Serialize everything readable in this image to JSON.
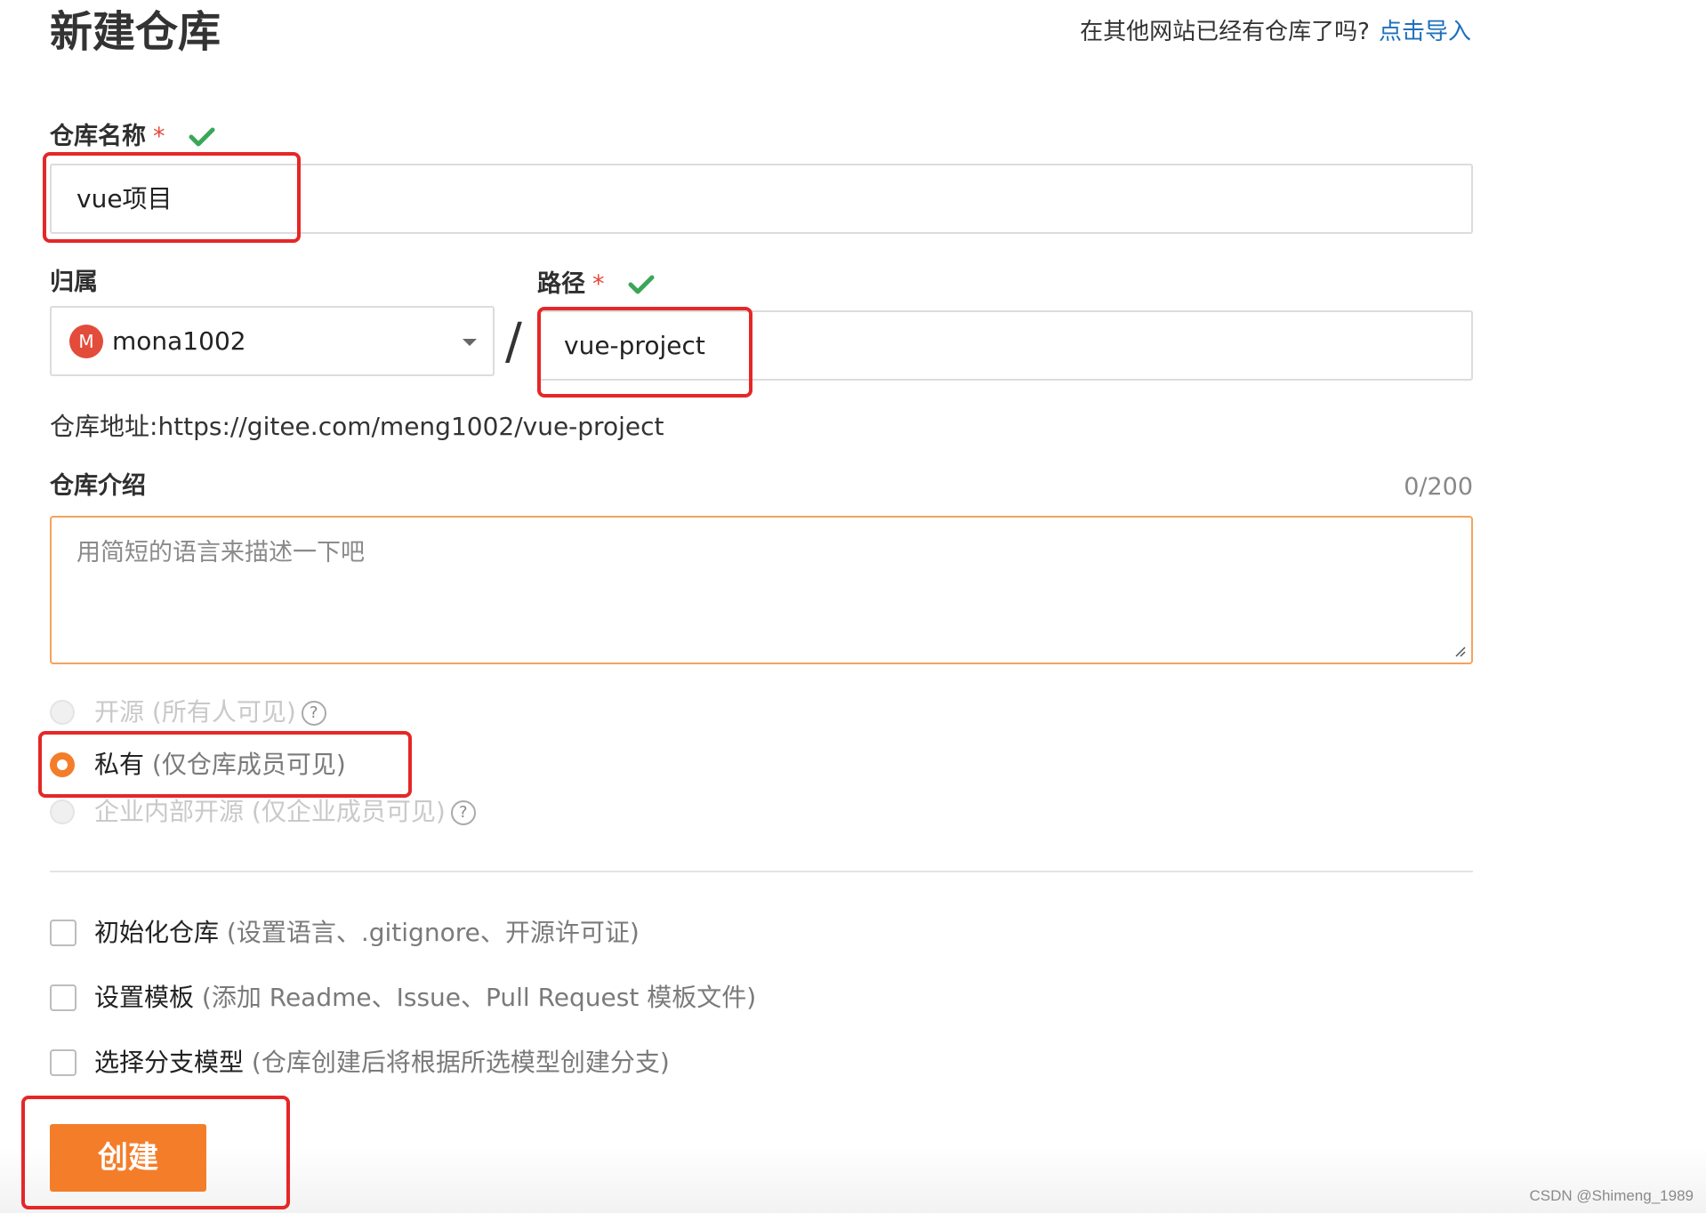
{
  "header": {
    "title": "新建仓库",
    "import_hint": "在其他网站已经有仓库了吗?",
    "import_link": "点击导入"
  },
  "form": {
    "repo_name": {
      "label": "仓库名称",
      "required_mark": "*",
      "value": "vue项目"
    },
    "owner": {
      "label": "归属",
      "avatar_letter": "M",
      "value": "mona1002"
    },
    "separator": "/",
    "path": {
      "label": "路径",
      "required_mark": "*",
      "value": "vue-project"
    },
    "repo_url": {
      "label": "仓库地址:",
      "value": "https://gitee.com/meng1002/vue-project"
    },
    "description": {
      "label": "仓库介绍",
      "counter": "0/200",
      "placeholder": "用简短的语言来描述一下吧"
    },
    "visibility": [
      {
        "label": "开源",
        "note": "(所有人可见)",
        "state": "disabled",
        "help": "?"
      },
      {
        "label": "私有",
        "note": "(仅仓库成员可见)",
        "state": "checked"
      },
      {
        "label": "企业内部开源",
        "note": "(仅企业成员可见)",
        "state": "disabled",
        "help": "?"
      }
    ],
    "options": [
      {
        "label": "初始化仓库",
        "note": "(设置语言、.gitignore、开源许可证)",
        "checked": false
      },
      {
        "label": "设置模板",
        "note": "(添加 Readme、Issue、Pull Request 模板文件)",
        "checked": false
      },
      {
        "label": "选择分支模型",
        "note": "(仓库创建后将根据所选模型创建分支)",
        "checked": false
      }
    ],
    "submit_label": "创建"
  },
  "watermark": "CSDN @Shimeng_1989",
  "colors": {
    "accent": "#f47d2a",
    "link": "#1e6fbd",
    "required": "#e8473a",
    "valid_check": "#3aa757",
    "annotation": "#e52727"
  }
}
